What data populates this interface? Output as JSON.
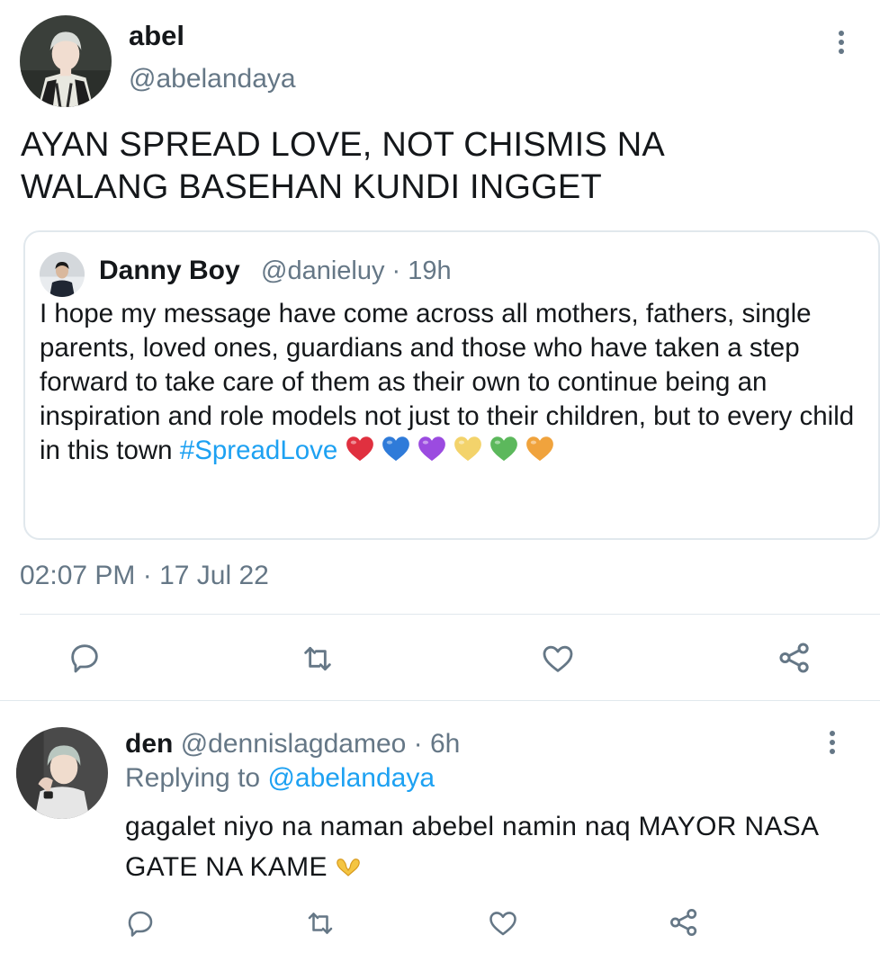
{
  "main_tweet": {
    "display_name": "abel",
    "handle": "@abelandaya",
    "text": "AYAN SPREAD LOVE, NOT CHISMIS NA\nWALANG BASEHAN KUNDI INGGET",
    "timestamp": "02:07 PM · 17 Jul 22",
    "more_icon": "more-vertical-icon"
  },
  "quoted_tweet": {
    "display_name": "Danny Boy",
    "meta": "@danieluy · 19h",
    "text": "I hope my message have come across all mothers, fathers, single parents, loved ones, guardians and those who have taken a step forward to take care of them as their own to continue being an inspiration and role models not just to their children, but to every child in this town",
    "hashtag": "#SpreadLove",
    "hearts": [
      "#e0303f",
      "#2f7bd9",
      "#9b4be0",
      "#f3d36b",
      "#5cb85c",
      "#f0a33d"
    ]
  },
  "actions": {
    "reply_icon": "reply-icon",
    "retweet_icon": "retweet-icon",
    "like_icon": "heart-icon",
    "share_icon": "share-icon",
    "icon_color": "#657786"
  },
  "reply_tweet": {
    "display_name": "den",
    "meta": "@dennislagdameo · 6h",
    "replying_prefix": "Replying to",
    "replying_handle": "@abelandaya",
    "text": "gagalet niyo na naman abebel namin naq MAYOR NASA GATE NA KAME",
    "emoji": "heart-hands-emoji"
  },
  "colors": {
    "accent": "#1da1f2",
    "secondary_text": "#657786",
    "border": "#e1e8ed"
  }
}
